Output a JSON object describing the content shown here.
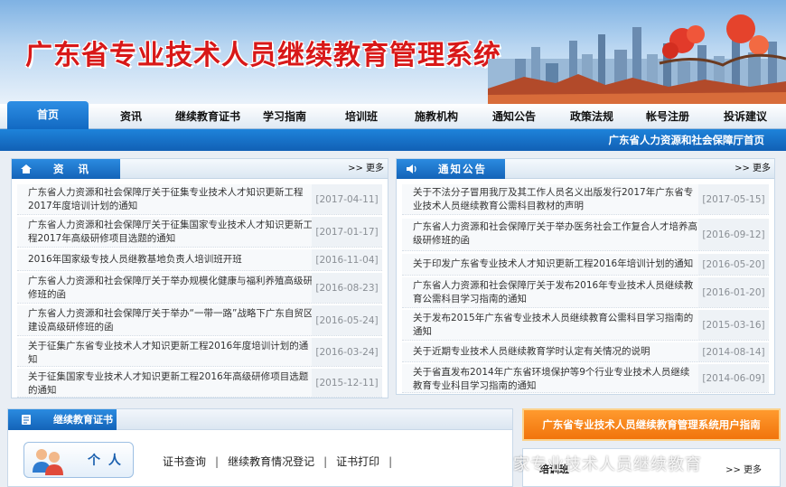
{
  "header": {
    "site_title": "广东省专业技术人员继续教育管理系统"
  },
  "nav": {
    "items": [
      {
        "label": "首页",
        "active": true
      },
      {
        "label": "资讯"
      },
      {
        "label": "继续教育证书"
      },
      {
        "label": "学习指南"
      },
      {
        "label": "培训班"
      },
      {
        "label": "施教机构"
      },
      {
        "label": "通知公告"
      },
      {
        "label": "政策法规"
      },
      {
        "label": "帐号注册"
      },
      {
        "label": "投诉建议"
      }
    ],
    "dept_link": "广东省人力资源和社会保障厅首页"
  },
  "news": {
    "title": "资 讯",
    "more": ">> 更多",
    "items": [
      {
        "text": "广东省人力资源和社会保障厅关于征集专业技术人才知识更新工程2017年度培训计划的通知",
        "date": "[2017-04-11]"
      },
      {
        "text": "广东省人力资源和社会保障厅关于征集国家专业技术人才知识更新工程2017年高级研修项目选题的通知",
        "date": "[2017-01-17]"
      },
      {
        "text": "2016年国家级专技人员继教基地负责人培训班开班",
        "date": "[2016-11-04]"
      },
      {
        "text": "广东省人力资源和社会保障厅关于举办规模化健康与福利养殖高级研修班的函",
        "date": "[2016-08-23]"
      },
      {
        "text": "广东省人力资源和社会保障厅关于举办“一带一路”战略下广东自贸区建设高级研修班的函",
        "date": "[2016-05-24]"
      },
      {
        "text": "关于征集广东省专业技术人才知识更新工程2016年度培训计划的通知",
        "date": "[2016-03-24]"
      },
      {
        "text": "关于征集国家专业技术人才知识更新工程2016年高级研修项目选题的通知",
        "date": "[2015-12-11]"
      }
    ]
  },
  "notice": {
    "title": "通知公告",
    "more": ">> 更多",
    "items": [
      {
        "text": "关于不法分子冒用我厅及其工作人员名义出版发行2017年广东省专业技术人员继续教育公需科目教材的声明",
        "date": "[2017-05-15]"
      },
      {
        "text": "广东省人力资源和社会保障厅关于举办医务社会工作复合人才培养高级研修班的函",
        "date": "[2016-09-12]"
      },
      {
        "text": "关于印发广东省专业技术人才知识更新工程2016年培训计划的通知",
        "date": "[2016-05-20]"
      },
      {
        "text": "广东省人力资源和社会保障厅关于发布2016年专业技术人员继续教育公需科目学习指南的通知",
        "date": "[2016-01-20]"
      },
      {
        "text": "关于发布2015年广东省专业技术人员继续教育公需科目学习指南的通知",
        "date": "[2015-03-16]"
      },
      {
        "text": "关于近期专业技术人员继续教育学时认定有关情况的说明",
        "date": "[2014-08-14]"
      },
      {
        "text": "关于省直发布2014年广东省环境保护等9个行业专业技术人员继续教育专业科目学习指南的通知",
        "date": "[2014-06-09]"
      }
    ]
  },
  "cert": {
    "title": "继续教育证书",
    "person_button": "个 人",
    "links": [
      "证书查询",
      "继续教育情况登记",
      "证书打印"
    ],
    "separator": "|"
  },
  "guide": {
    "button": "广东省专业技术人员继续教育管理系统用户指南",
    "sub_label": "培训班",
    "more": ">> 更多"
  },
  "watermark": "家专业技术人员继续教育"
}
